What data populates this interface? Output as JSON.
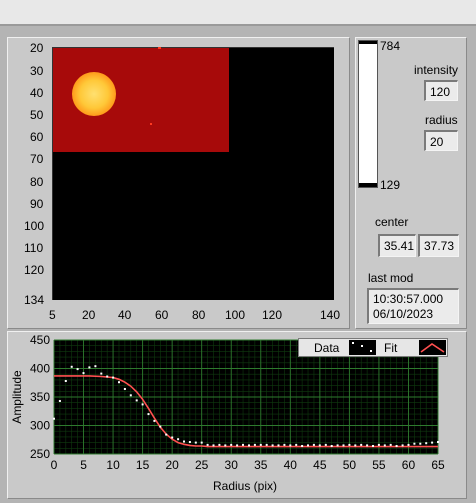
{
  "image_panel": {
    "y_ticks": [
      "20",
      "30",
      "40",
      "50",
      "60",
      "70",
      "80",
      "90",
      "100",
      "110",
      "120",
      "134"
    ],
    "x_ticks": [
      "5",
      "20",
      "40",
      "60",
      "80",
      "100",
      "120",
      "140"
    ]
  },
  "colorbar": {
    "max_label": "784",
    "min_label": "129"
  },
  "controls": {
    "intensity_label": "intensity",
    "intensity_value": "120",
    "radius_label": "radius",
    "radius_value": "20",
    "center_label": "center",
    "center_x": "35.41",
    "center_y": "37.73",
    "last_mod_label": "last mod",
    "last_mod_time": "10:30:57.000",
    "last_mod_date": "06/10/2023"
  },
  "legend": {
    "data_label": "Data",
    "fit_label": "Fit"
  },
  "colors": {
    "image_red": "#a80808",
    "spot": "#ffd040",
    "plot_bg": "#000000",
    "grid": "#1e5a1e",
    "fit": "#ff5050",
    "data": "#ffffff"
  },
  "chart_data": {
    "type": "scatter",
    "xlabel": "Radius (pix)",
    "ylabel": "Amplitude",
    "xlim": [
      0,
      65
    ],
    "ylim": [
      250,
      450
    ],
    "x_ticks": [
      0,
      5,
      10,
      15,
      20,
      25,
      30,
      35,
      40,
      45,
      50,
      55,
      60,
      65
    ],
    "y_ticks": [
      250,
      300,
      350,
      400,
      450
    ],
    "series": [
      {
        "name": "Data",
        "type": "scatter",
        "x": [
          0,
          1,
          2,
          3,
          4,
          5,
          6,
          7,
          8,
          9,
          10,
          11,
          12,
          13,
          14,
          15,
          16,
          17,
          18,
          19,
          20,
          21,
          22,
          23,
          24,
          25,
          26,
          27,
          28,
          29,
          30,
          31,
          32,
          33,
          34,
          35,
          36,
          37,
          38,
          39,
          40,
          41,
          42,
          43,
          44,
          45,
          46,
          47,
          48,
          49,
          50,
          51,
          52,
          53,
          54,
          55,
          56,
          57,
          58,
          59,
          60,
          61,
          62,
          63,
          64,
          65
        ],
        "y": [
          312,
          343,
          378,
          403,
          399,
          392,
          402,
          404,
          391,
          386,
          384,
          376,
          364,
          353,
          344,
          337,
          320,
          308,
          298,
          284,
          279,
          276,
          272,
          271,
          270,
          270,
          266,
          265,
          266,
          265,
          266,
          265,
          266,
          265,
          266,
          266,
          266,
          265,
          265,
          266,
          265,
          266,
          264,
          265,
          266,
          265,
          266,
          264,
          265,
          265,
          266,
          265,
          266,
          265,
          264,
          266,
          265,
          266,
          264,
          265,
          266,
          268,
          268,
          269,
          270,
          271
        ]
      },
      {
        "name": "Fit",
        "type": "line",
        "x": [
          0,
          2,
          4,
          6,
          8,
          10,
          11,
          12,
          13,
          14,
          15,
          16,
          17,
          18,
          19,
          20,
          21,
          22,
          23,
          24,
          25,
          26,
          28,
          30,
          35,
          40,
          45,
          50,
          55,
          60,
          65
        ],
        "y": [
          387,
          387,
          387,
          387,
          386,
          384,
          381,
          376,
          369,
          359,
          346,
          330,
          313,
          297,
          285,
          276,
          270,
          267,
          265,
          264,
          264,
          263,
          263,
          263,
          263,
          263,
          263,
          263,
          263,
          263,
          263
        ]
      }
    ]
  }
}
